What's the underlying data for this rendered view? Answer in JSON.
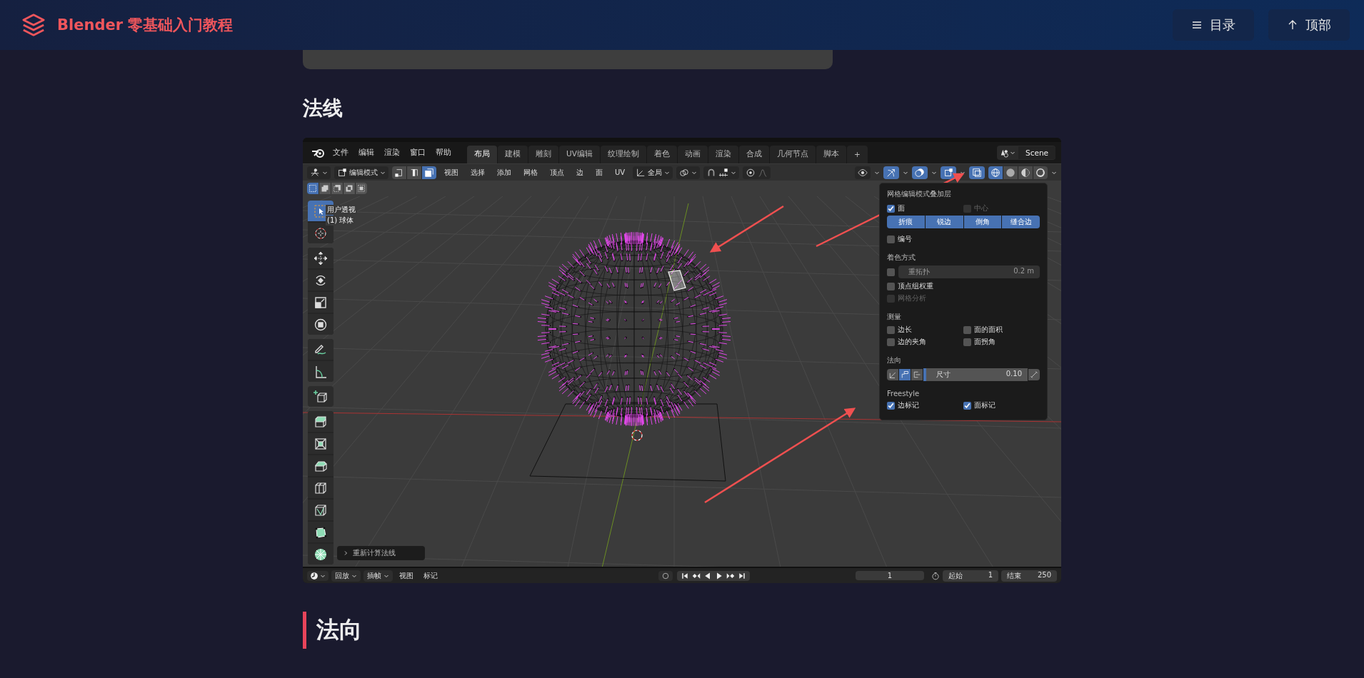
{
  "site": {
    "title": "Blender 零基础入门教程",
    "nav": [
      {
        "kind": "toc",
        "label": "目录"
      },
      {
        "kind": "top",
        "label": "顶部"
      }
    ]
  },
  "section_heading": "法线",
  "blender": {
    "menus": [
      "文件",
      "编辑",
      "渲染",
      "窗口",
      "帮助"
    ],
    "workspaces": [
      {
        "label": "布局",
        "selected": true
      },
      {
        "label": "建模",
        "selected": false
      },
      {
        "label": "雕刻",
        "selected": false
      },
      {
        "label": "UV编辑",
        "selected": false
      },
      {
        "label": "纹理绘制",
        "selected": false
      },
      {
        "label": "着色",
        "selected": false
      },
      {
        "label": "动画",
        "selected": false
      },
      {
        "label": "渲染",
        "selected": false
      },
      {
        "label": "合成",
        "selected": false
      },
      {
        "label": "几何节点",
        "selected": false
      },
      {
        "label": "脚本",
        "selected": false
      }
    ],
    "add_tab": "+",
    "scene": "Scene",
    "mode": "编辑模式",
    "select_modes": [
      {
        "kind": "vertex",
        "selected": false
      },
      {
        "kind": "edge",
        "selected": false
      },
      {
        "kind": "face",
        "selected": true
      }
    ],
    "header_menus": [
      "视图",
      "选择",
      "添加",
      "网格",
      "顶点",
      "边",
      "面",
      "UV"
    ],
    "orientation": "全局",
    "view_toggles": [
      {
        "kind": "visibility",
        "selected": false
      },
      {
        "kind": "gizmo",
        "selected": true
      },
      {
        "kind": "overlay",
        "selected": true
      },
      {
        "kind": "mesh_overlay",
        "selected": true
      },
      {
        "kind": "xray",
        "selected": true
      }
    ],
    "shading_modes": [
      {
        "kind": "wireframe",
        "selected": true
      },
      {
        "kind": "solid",
        "selected": false
      },
      {
        "kind": "material",
        "selected": false
      },
      {
        "kind": "rendered",
        "selected": false
      }
    ],
    "box_modes": [
      {
        "kind": "set",
        "selected": true
      },
      {
        "kind": "extend",
        "selected": false
      },
      {
        "kind": "subtract",
        "selected": false
      },
      {
        "kind": "invert",
        "selected": false
      },
      {
        "kind": "intersect",
        "selected": false
      }
    ],
    "tool_groups": [
      {
        "tools": [
          {
            "kind": "select",
            "selected": true
          },
          {
            "kind": "cursor",
            "selected": false
          }
        ]
      },
      {
        "tools": [
          {
            "kind": "move",
            "selected": false
          },
          {
            "kind": "rotate",
            "selected": false
          },
          {
            "kind": "scale",
            "selected": false
          },
          {
            "kind": "transform",
            "selected": false
          }
        ]
      },
      {
        "tools": [
          {
            "kind": "annotate",
            "selected": false
          },
          {
            "kind": "measure",
            "selected": false
          }
        ]
      },
      {
        "tools": [
          {
            "kind": "add_cube",
            "selected": false
          }
        ]
      },
      {
        "tools": [
          {
            "kind": "extrude",
            "selected": false
          },
          {
            "kind": "inset",
            "selected": false
          },
          {
            "kind": "bevel",
            "selected": false
          },
          {
            "kind": "loop_cut",
            "selected": false
          },
          {
            "kind": "knife",
            "selected": false
          },
          {
            "kind": "poly_build",
            "selected": false
          },
          {
            "kind": "spin",
            "selected": false
          }
        ]
      }
    ],
    "view_name": "用户透视",
    "object_name": "(1) 球体",
    "operator": "重新计算法线",
    "overlay": {
      "title": "网格编辑模式叠加层",
      "rows": [
        {
          "kind": "checks",
          "items": [
            {
              "label": "面",
              "checked": true,
              "disabled": false
            },
            {
              "label": "中心",
              "checked": false,
              "disabled": true
            }
          ]
        },
        {
          "kind": "buttons",
          "items": [
            {
              "label": "折痕",
              "on": true
            },
            {
              "label": "锐边",
              "on": true
            },
            {
              "label": "倒角",
              "on": true
            },
            {
              "label": "缝合边",
              "on": true
            }
          ]
        },
        {
          "kind": "checks",
          "items": [
            {
              "label": "编号",
              "checked": false,
              "disabled": false
            }
          ]
        },
        {
          "kind": "heading",
          "text": "着色方式"
        },
        {
          "kind": "check_slider",
          "checked": false,
          "label": "重拓扑",
          "value": "0.2 m"
        },
        {
          "kind": "checks",
          "items": [
            {
              "label": "顶点组权重",
              "checked": false,
              "disabled": false
            }
          ]
        },
        {
          "kind": "checks",
          "items": [
            {
              "label": "网格分析",
              "checked": false,
              "disabled": true
            }
          ]
        },
        {
          "kind": "heading",
          "text": "测量"
        },
        {
          "kind": "checks",
          "items": [
            {
              "label": "边长",
              "checked": false,
              "disabled": false
            },
            {
              "label": "面的面积",
              "checked": false,
              "disabled": false
            }
          ]
        },
        {
          "kind": "checks",
          "items": [
            {
              "label": "边的夹角",
              "checked": false,
              "disabled": false
            },
            {
              "label": "面拐角",
              "checked": false,
              "disabled": false
            }
          ]
        },
        {
          "kind": "heading",
          "text": "法向"
        },
        {
          "kind": "normals",
          "modes": [
            {
              "kind": "vertex",
              "selected": false
            },
            {
              "kind": "split",
              "selected": true
            },
            {
              "kind": "face",
              "selected": false
            }
          ],
          "label": "尺寸",
          "value": "0.10"
        },
        {
          "kind": "heading",
          "text": "Freestyle"
        },
        {
          "kind": "checks",
          "items": [
            {
              "label": "边标记",
              "checked": true,
              "disabled": false
            },
            {
              "label": "面标记",
              "checked": true,
              "disabled": false
            }
          ]
        }
      ]
    },
    "timeline": {
      "menus": [
        {
          "label": "回放",
          "dropdown": true
        },
        {
          "label": "插帧",
          "dropdown": true
        },
        {
          "label": "视图",
          "dropdown": false
        },
        {
          "label": "标记",
          "dropdown": false
        }
      ],
      "frame": "1",
      "start_label": "起始",
      "start": "1",
      "end_label": "结束",
      "end": "250"
    }
  },
  "next_heading": "法向"
}
